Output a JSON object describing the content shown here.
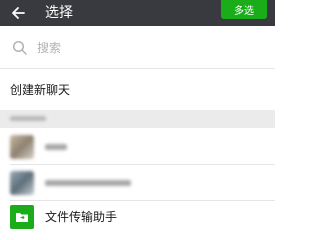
{
  "header": {
    "title": "选择",
    "multi_select_label": "多选",
    "back_icon": "arrow-left-icon",
    "background_color": "#393a3f",
    "accent_color": "#1aad19"
  },
  "search": {
    "placeholder": "搜索",
    "icon": "search-icon"
  },
  "create_chat": {
    "label": "创建新聊天"
  },
  "recent_chats": {
    "items": [
      {
        "name": ""
      },
      {
        "name": ""
      }
    ]
  },
  "file_transfer": {
    "label": "文件传输助手",
    "icon": "folder-transfer-icon"
  }
}
